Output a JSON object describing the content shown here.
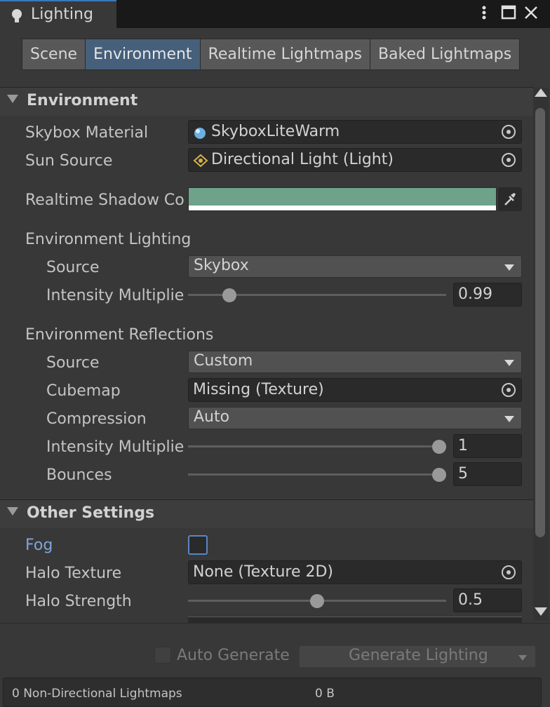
{
  "window": {
    "tab_label": "Lighting",
    "icons": [
      "bulb-icon",
      "kebab-menu-icon",
      "maximize-icon",
      "close-icon"
    ]
  },
  "subtabs": [
    {
      "label": "Scene",
      "active": false
    },
    {
      "label": "Environment",
      "active": true
    },
    {
      "label": "Realtime Lightmaps",
      "active": false
    },
    {
      "label": "Baked Lightmaps",
      "active": false
    }
  ],
  "environment": {
    "header": "Environment",
    "skybox_label": "Skybox Material",
    "skybox_value": "SkyboxLiteWarm",
    "sun_label": "Sun Source",
    "sun_value": "Directional Light (Light)",
    "shadow_label": "Realtime Shadow Color",
    "shadow_color": "#6fa28b",
    "env_lighting_label": "Environment Lighting",
    "lighting_source_label": "Source",
    "lighting_source_value": "Skybox",
    "lighting_intensity_label": "Intensity Multiplier",
    "lighting_intensity_value": "0.99",
    "lighting_intensity_fraction": 0.14,
    "env_reflections_label": "Environment Reflections",
    "refl_source_label": "Source",
    "refl_source_value": "Custom",
    "cubemap_label": "Cubemap",
    "cubemap_value": "Missing (Texture)",
    "compression_label": "Compression",
    "compression_value": "Auto",
    "refl_intensity_label": "Intensity Multiplier",
    "refl_intensity_value": "1",
    "refl_intensity_fraction": 1.0,
    "bounces_label": "Bounces",
    "bounces_value": "5",
    "bounces_fraction": 1.0
  },
  "other": {
    "header": "Other Settings",
    "fog_label": "Fog",
    "fog_checked": false,
    "halo_texture_label": "Halo Texture",
    "halo_texture_value": "None (Texture 2D)",
    "halo_strength_label": "Halo Strength",
    "halo_strength_value": "0.5",
    "halo_strength_fraction": 0.5
  },
  "footer": {
    "auto_generate_label": "Auto Generate",
    "generate_label": "Generate Lighting",
    "status_left": "0 Non-Directional Lightmaps",
    "status_right": "0 B"
  },
  "colors": {
    "accent": "#3a79bb",
    "fog_label": "#7ea5dc",
    "active_tab": "#46607c"
  }
}
